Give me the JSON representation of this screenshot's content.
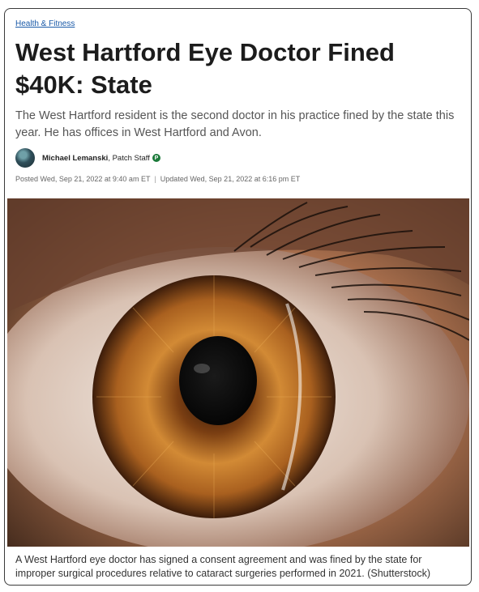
{
  "article": {
    "category": "Health & Fitness",
    "headline": "West Hartford Eye Doctor Fined $40K: State",
    "dek": "The West Hartford resident is the second doctor in his practice fined by the state this year. He has offices in West Hartford and Avon.",
    "author": {
      "name": "Michael Lemanski",
      "role": "Patch Staff",
      "badge": "P"
    },
    "posted": "Posted Wed, Sep 21, 2022 at 9:40 am ET",
    "separator": "|",
    "updated": "Updated Wed, Sep 21, 2022 at 6:16 pm ET",
    "image_caption": "A West Hartford eye doctor has signed a consent agreement and was fined by the state for improper surgical procedures relative to cataract surgeries performed in 2021. (Shutterstock)"
  },
  "colors": {
    "link": "#1a5aa8",
    "headline": "#1c1c1c",
    "badge": "#1b7a3a",
    "iris": "#c9822f"
  }
}
